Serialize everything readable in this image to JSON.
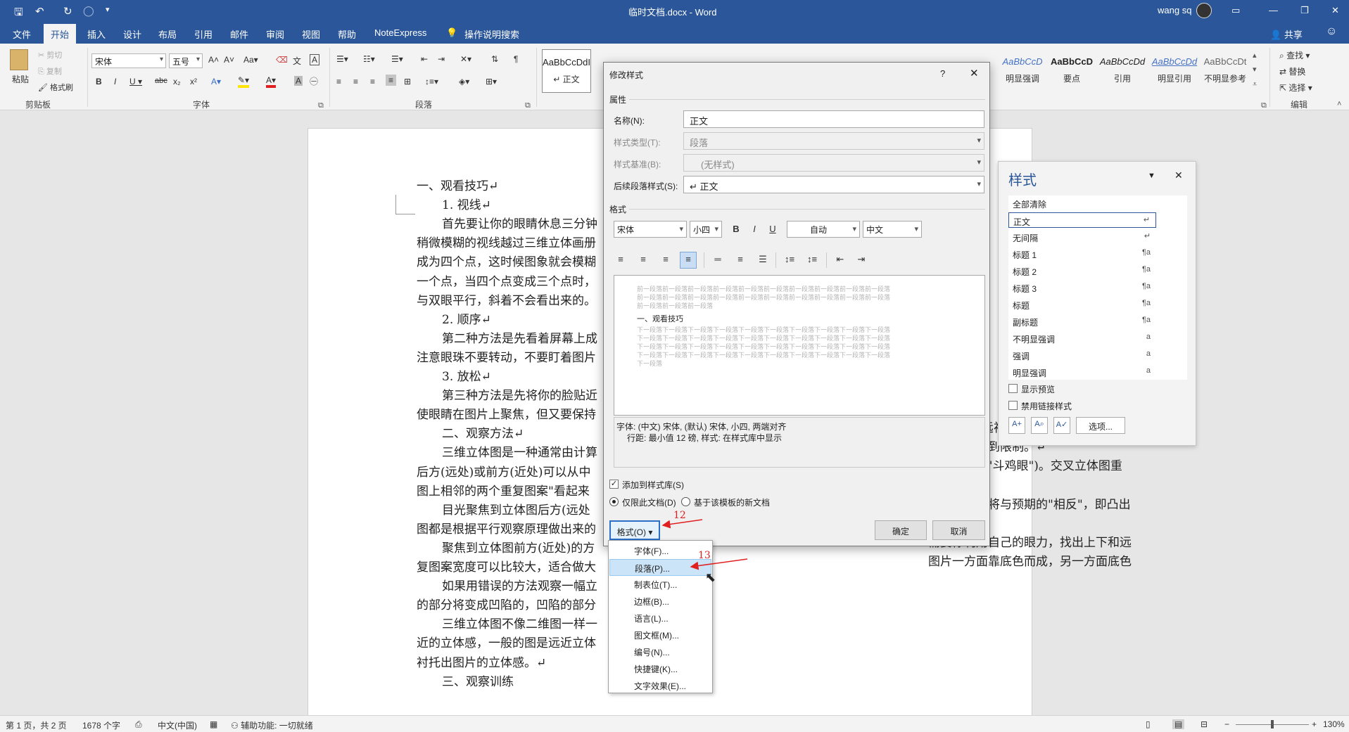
{
  "titlebar": {
    "doc_title": "临时文档.docx - Word",
    "user": "wang sq"
  },
  "tabs": [
    {
      "label": "文件"
    },
    {
      "label": "开始"
    },
    {
      "label": "插入"
    },
    {
      "label": "设计"
    },
    {
      "label": "布局"
    },
    {
      "label": "引用"
    },
    {
      "label": "邮件"
    },
    {
      "label": "审阅"
    },
    {
      "label": "视图"
    },
    {
      "label": "帮助"
    },
    {
      "label": "NoteExpress"
    },
    {
      "label": "操作说明搜索"
    }
  ],
  "share": "共享",
  "ribbon": {
    "clipboard": {
      "paste": "粘贴",
      "cut": "剪切",
      "copy": "复制",
      "painter": "格式刷",
      "label": "剪贴板"
    },
    "font": {
      "name": "宋体",
      "size": "五号",
      "label": "字体"
    },
    "paragraph": {
      "label": "段落"
    },
    "styles": [
      {
        "preview": "AaBbCcDdI",
        "name": "↵ 正文"
      },
      {
        "preview": "AaBbCcD",
        "name": "明显强调"
      },
      {
        "preview": "AaBbCcD",
        "name": "要点"
      },
      {
        "preview": "AaBbCcDd",
        "name": "引用"
      },
      {
        "preview": "AaBbCcDd",
        "name": "明显引用"
      },
      {
        "preview": "AaBbCcDt",
        "name": "不明显参考"
      }
    ],
    "editing": {
      "find": "查找",
      "replace": "替换",
      "select": "选择",
      "label": "编辑"
    }
  },
  "document": {
    "lines": [
      "一、观看技巧↵",
      "1. 视线↵",
      "首先要让你的眼睛休息三分钟",
      "稍微模糊的视线越过三维立体画册",
      "成为四个点，这时候图象就会模糊",
      "一个点，当四个点变成三个点时，",
      "与双眼平行，斜着不会看出来的。",
      "2. 顺序↵",
      "第二种方法是先看着屏幕上成",
      "注意眼珠不要转动，不要盯着图片",
      "3. 放松↵",
      "第三种方法是先将你的脸贴近",
      "使眼睛在图片上聚焦，但又要保持",
      "二、观察方法↵",
      "三维立体图是一种通常由计算",
      "后方(远处)或前方(近处)可以从中",
      "图上相邻的两个重复图案\"看起来",
      "目光聚焦到立体图后方(远处",
      "图都是根据平行观察原理做出来的",
      "聚焦到立体图前方(近处)的方",
      "复图案宽度可以比较大，适合做大",
      "如果用错误的方法观察一幅立",
      "的部分将变成凹陷的，凹陷的部分",
      "三维立体图不像二维图一样一",
      "近的立体感，一般的图是远近立体",
      "衬托出图片的立体感。↵",
      "三、观察训练"
    ],
    "right_lines": [
      "法（或叫\"远视法\"）。绝大部分的立体",
      "图案宽度受到限制。↵",
      "称\"对眼\"或\"斗鸡眼\")。交叉立体图重",
      "。↵",
      "的立体影像将与预期的\"相反\"，即凸出",
      "需要你利用自己的眼力，找出上下和远",
      "图片一方面靠底色而成，另一方面底色"
    ]
  },
  "dialog": {
    "title": "修改样式",
    "help": "?",
    "close": "✕",
    "section_props": "属性",
    "name_label": "名称(N):",
    "name_value": "正文",
    "type_label": "样式类型(T):",
    "type_value": "段落",
    "base_label": "样式基准(B):",
    "base_value": "(无样式)",
    "next_label": "后续段落样式(S):",
    "next_value": "↵ 正文",
    "section_format": "格式",
    "font_name": "宋体",
    "font_size": "小四",
    "bold": "B",
    "italic": "I",
    "underline": "U",
    "color": "自动",
    "script": "中文",
    "preview_prev": [
      "前一段落前一段落前一段落前一段落前一段落前一段落前一段落前一段落前一段落前一段落",
      "前一段落前一段落前一段落前一段落前一段落前一段落前一段落前一段落前一段落前一段落",
      "前一段落前一段落前一段落"
    ],
    "preview_main": "一、观看技巧",
    "preview_next": [
      "下一段落下一段落下一段落下一段落下一段落下一段落下一段落下一段落下一段落下一段落",
      "下一段落下一段落下一段落下一段落下一段落下一段落下一段落下一段落下一段落下一段落",
      "下一段落下一段落下一段落下一段落下一段落下一段落下一段落下一段落下一段落下一段落",
      "下一段落下一段落下一段落下一段落下一段落下一段落下一段落下一段落下一段落下一段落",
      "下一段落"
    ],
    "desc1": "字体: (中文) 宋体, (默认) 宋体, 小四, 两端对齐",
    "desc2": "行距: 最小值 12 磅, 样式: 在样式库中显示",
    "add_gallery": "添加到样式库(S)",
    "only_doc": "仅限此文档(D)",
    "new_docs": "基于该模板的新文档",
    "format_btn": "格式(O) ▾",
    "ok": "确定",
    "cancel": "取消"
  },
  "menu": [
    {
      "label": "字体(F)..."
    },
    {
      "label": "段落(P)..."
    },
    {
      "label": "制表位(T)..."
    },
    {
      "label": "边框(B)..."
    },
    {
      "label": "语言(L)..."
    },
    {
      "label": "图文框(M)..."
    },
    {
      "label": "编号(N)..."
    },
    {
      "label": "快捷键(K)..."
    },
    {
      "label": "文字效果(E)..."
    }
  ],
  "annotations": {
    "a12": "12",
    "a13": "13"
  },
  "style_pane": {
    "title": "样式",
    "items": [
      {
        "label": "全部清除",
        "mark": ""
      },
      {
        "label": "正文",
        "mark": "↵"
      },
      {
        "label": "无间隔",
        "mark": "↵"
      },
      {
        "label": "标题 1",
        "mark": "¶a"
      },
      {
        "label": "标题 2",
        "mark": "¶a"
      },
      {
        "label": "标题 3",
        "mark": "¶a"
      },
      {
        "label": "标题",
        "mark": "¶a"
      },
      {
        "label": "副标题",
        "mark": "¶a"
      },
      {
        "label": "不明显强调",
        "mark": "a"
      },
      {
        "label": "强调",
        "mark": "a"
      },
      {
        "label": "明显强调",
        "mark": "a"
      }
    ],
    "show_preview": "显示预览",
    "disable_linked": "禁用链接样式",
    "options": "选项..."
  },
  "status": {
    "page": "第 1 页，共 2 页",
    "words": "1678 个字",
    "lang": "中文(中国)",
    "access": "辅助功能: 一切就绪",
    "zoom": "130%"
  }
}
